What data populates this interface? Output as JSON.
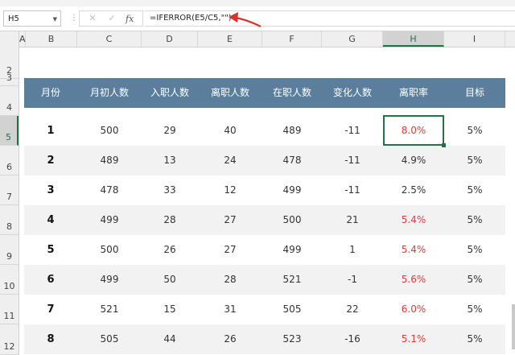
{
  "formula_bar": {
    "name_box": "H5",
    "formula": "=IFERROR(E5/C5,\"\")",
    "cancel_glyph": "✕",
    "enter_glyph": "✓",
    "fx_glyph": "fx"
  },
  "columns": [
    "A",
    "B",
    "C",
    "D",
    "E",
    "F",
    "G",
    "H",
    "I"
  ],
  "selected_column": "H",
  "rows": [
    "2",
    "3",
    "4",
    "5",
    "6",
    "7",
    "8",
    "9",
    "10",
    "11",
    "12"
  ],
  "selected_row": "5",
  "table": {
    "headers": [
      "月份",
      "月初人数",
      "入职人数",
      "离职人数",
      "在职人数",
      "变化人数",
      "离职率",
      "目标"
    ],
    "data": [
      {
        "month": "1",
        "start": "500",
        "hired": "29",
        "left": "40",
        "current": "489",
        "change": "-11",
        "rate": "8.0%",
        "target": "5%",
        "over": true
      },
      {
        "month": "2",
        "start": "489",
        "hired": "13",
        "left": "24",
        "current": "478",
        "change": "-11",
        "rate": "4.9%",
        "target": "5%",
        "over": false
      },
      {
        "month": "3",
        "start": "478",
        "hired": "33",
        "left": "12",
        "current": "499",
        "change": "-11",
        "rate": "2.5%",
        "target": "5%",
        "over": false
      },
      {
        "month": "4",
        "start": "499",
        "hired": "28",
        "left": "27",
        "current": "500",
        "change": "21",
        "rate": "5.4%",
        "target": "5%",
        "over": true
      },
      {
        "month": "5",
        "start": "500",
        "hired": "26",
        "left": "27",
        "current": "499",
        "change": "1",
        "rate": "5.4%",
        "target": "5%",
        "over": true
      },
      {
        "month": "6",
        "start": "499",
        "hired": "50",
        "left": "28",
        "current": "521",
        "change": "-1",
        "rate": "5.6%",
        "target": "5%",
        "over": true
      },
      {
        "month": "7",
        "start": "521",
        "hired": "15",
        "left": "31",
        "current": "505",
        "change": "22",
        "rate": "6.0%",
        "target": "5%",
        "over": true
      },
      {
        "month": "8",
        "start": "505",
        "hired": "44",
        "left": "26",
        "current": "523",
        "change": "-16",
        "rate": "5.1%",
        "target": "5%",
        "over": true
      }
    ]
  },
  "colors": {
    "header_bg": "#5b7e9c",
    "alert_red": "#e03a3a",
    "selection_green": "#217346",
    "annotation_arrow": "#d9342b"
  }
}
